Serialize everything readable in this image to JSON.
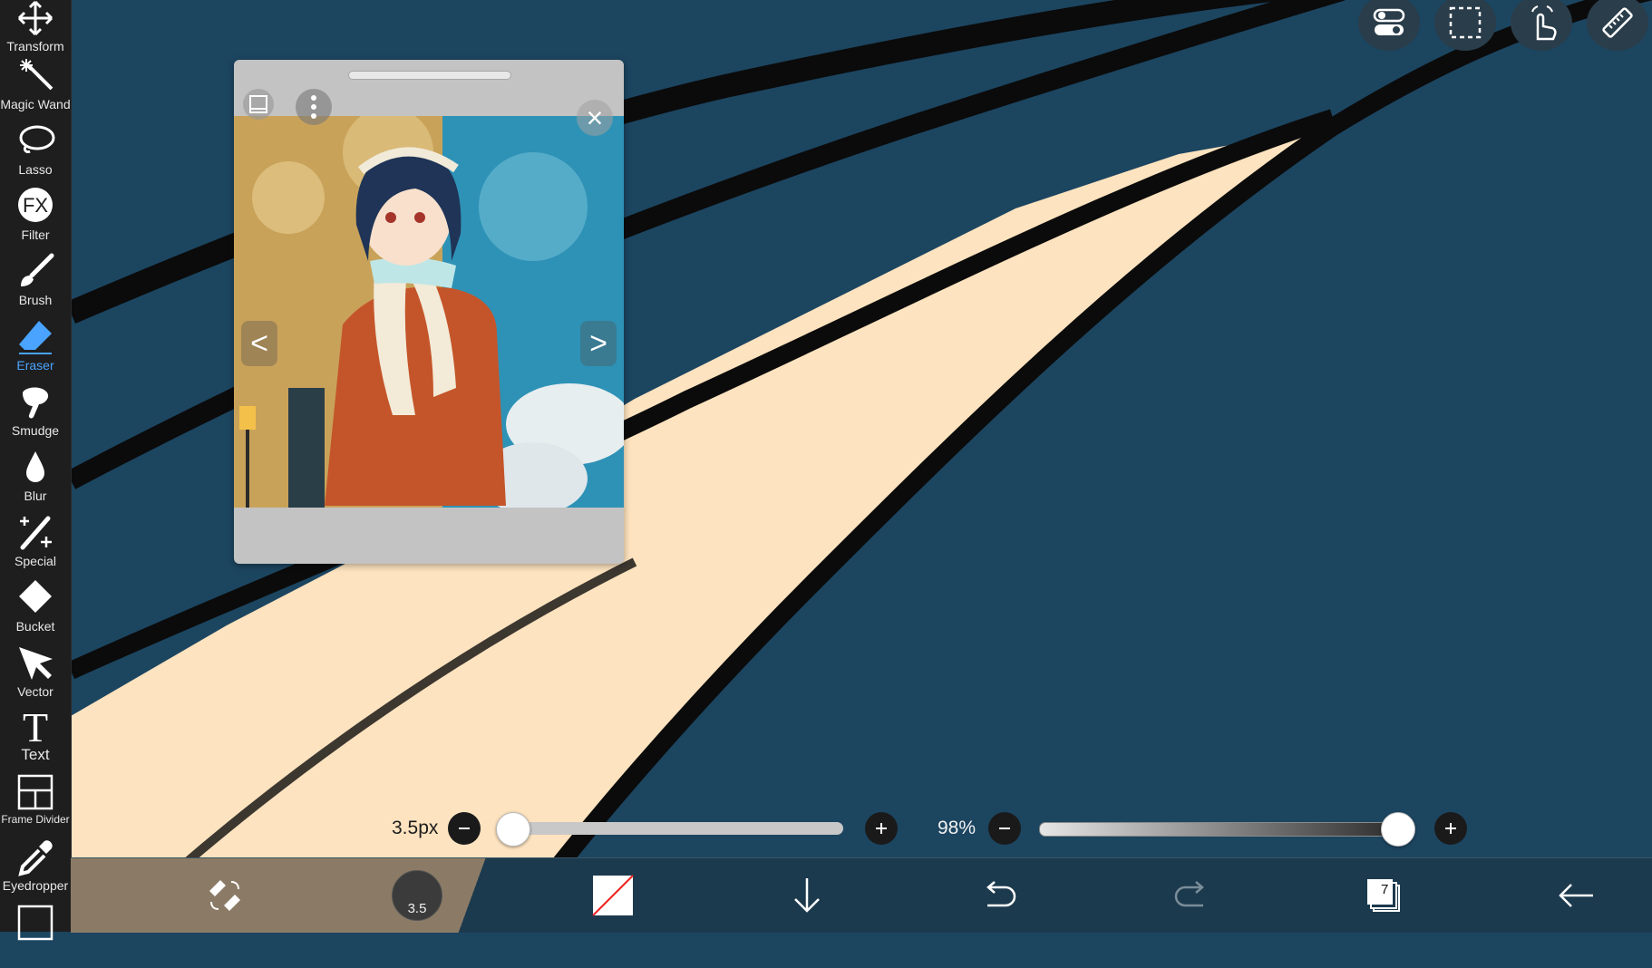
{
  "toolbar": {
    "tools": [
      {
        "label": "Transform",
        "icon": "move-arrows-icon"
      },
      {
        "label": "Magic Wand",
        "icon": "magic-wand-icon"
      },
      {
        "label": "Lasso",
        "icon": "lasso-icon"
      },
      {
        "label": "Filter",
        "icon": "fx-icon",
        "glyph": "FX"
      },
      {
        "label": "Brush",
        "icon": "brush-icon"
      },
      {
        "label": "Eraser",
        "icon": "eraser-icon",
        "active": true
      },
      {
        "label": "Smudge",
        "icon": "smudge-icon"
      },
      {
        "label": "Blur",
        "icon": "droplet-icon"
      },
      {
        "label": "Special",
        "icon": "sparkle-brush-icon"
      },
      {
        "label": "Bucket",
        "icon": "bucket-icon"
      },
      {
        "label": "Vector",
        "icon": "cursor-arrow-icon"
      },
      {
        "label": "Text",
        "icon": "text-icon",
        "glyph": "T"
      },
      {
        "label": "Frame Divider",
        "icon": "frame-divider-icon"
      },
      {
        "label": "Eyedropper",
        "icon": "eyedropper-icon"
      }
    ],
    "active_color": "#4aa3ff"
  },
  "top_buttons": [
    "toggle-switches-icon",
    "selection-marquee-icon",
    "hand-gesture-icon",
    "ruler-icon"
  ],
  "reference_window": {
    "icons": [
      "reference-layer-icon",
      "more-options-icon",
      "close-icon",
      "previous-arrow-icon",
      "next-arrow-icon"
    ],
    "prev_glyph": "<",
    "next_glyph": ">",
    "close_glyph": "×"
  },
  "brush_size": {
    "label": "3.5px",
    "value_fraction": 0.03
  },
  "opacity": {
    "label": "98%",
    "value_fraction": 0.98
  },
  "bottom_bar": {
    "brush_size_value": "3.5",
    "layers_count": "7",
    "icons": [
      "eraser-swap-icon",
      "brush-size-preview-icon",
      "color-swatch-icon",
      "download-arrow-icon",
      "undo-icon",
      "redo-icon",
      "layers-icon",
      "back-arrow-icon"
    ]
  },
  "colors": {
    "canvas_blue": "#1c4560",
    "skin_cream": "#fde3bf",
    "line_black": "#0b0b0b"
  }
}
